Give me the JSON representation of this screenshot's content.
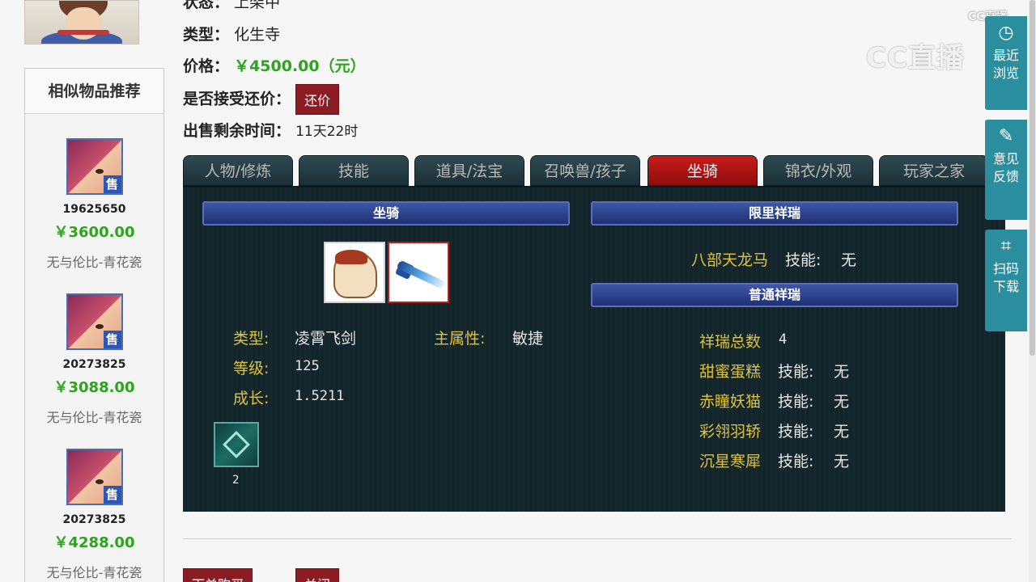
{
  "info": {
    "status_label": "状态：",
    "status_value": "上架中",
    "type_label": "类型：",
    "type_value": "化生寺",
    "price_label": "价格：",
    "price_value": "￥4500.00（元）",
    "bargain_label": "是否接受还价：",
    "bargain_button": "还价",
    "remaining_label": "出售剩余时间：",
    "remaining_value": "11天22时"
  },
  "sidebar": {
    "title": "相似物品推荐",
    "sale_tag": "售",
    "items": [
      {
        "id": "19625650",
        "price": "￥3600.00",
        "desc": "无与伦比-青花瓷"
      },
      {
        "id": "20273825",
        "price": "￥3088.00",
        "desc": "无与伦比-青花瓷"
      },
      {
        "id": "20273825",
        "price": "￥4288.00",
        "desc": "无与伦比-青花瓷"
      }
    ]
  },
  "tabs": [
    "人物/修炼",
    "技能",
    "道具/法宝",
    "召唤兽/孩子",
    "坐骑",
    "锦衣/外观",
    "玩家之家"
  ],
  "active_tab": "坐骑",
  "panel": {
    "mount_header": "坐骑",
    "limited_header": "限里祥瑞",
    "normal_header": "普通祥瑞",
    "mount": {
      "type_label": "类型:",
      "type_value": "凌霄飞剑",
      "main_attr_label": "主属性:",
      "main_attr_value": "敏捷",
      "level_label": "等级:",
      "level_value": "125",
      "growth_label": "成长:",
      "growth_value": "1.5211",
      "skill_count": "2"
    },
    "limited": {
      "name": "八部天龙马",
      "skill_label": "技能:",
      "skill_value": "无"
    },
    "normal_total_label": "祥瑞总数",
    "normal_total_value": "4",
    "normal": [
      {
        "name": "甜蜜蛋糕",
        "skill_label": "技能:",
        "skill_value": "无"
      },
      {
        "name": "赤瞳妖猫",
        "skill_label": "技能:",
        "skill_value": "无"
      },
      {
        "name": "彩翎羽轿",
        "skill_label": "技能:",
        "skill_value": "无"
      },
      {
        "name": "沉星寒犀",
        "skill_label": "技能:",
        "skill_value": "无"
      }
    ]
  },
  "actions": {
    "buy": "下单购买",
    "close": "关闭"
  },
  "float_panel": {
    "recent": "最近浏览",
    "feedback": "意见反馈",
    "scan": "扫码下载"
  },
  "watermark": {
    "large": "CC直播",
    "small": "CC直播"
  },
  "colors": {
    "accent_red": "#8c1c24",
    "price_green": "#2aa51c",
    "panel_bg": "#12252b",
    "side_teal": "#2b8e9e"
  }
}
